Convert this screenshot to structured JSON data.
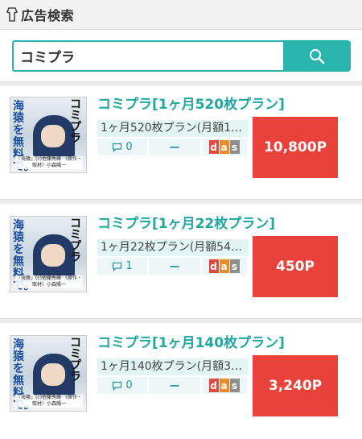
{
  "header": {
    "title": "広告検索",
    "logo_icon": "shirt-tag-icon"
  },
  "search": {
    "value": "コミプラ",
    "button_icon": "search-icon"
  },
  "items": [
    {
      "title": "コミプラ[1ヶ月520枚プラン]",
      "description": "1ヶ月520枚プラン(月額1…",
      "comments": "0",
      "dash": "ー",
      "badges": [
        "d",
        "a",
        "s"
      ],
      "price": "10,800P",
      "thumb": {
        "left_text": "海猿を無料で。",
        "right_text": "コミプラ",
        "caption": "『海猿』(c)佐藤秀峰 〈原作・取材〉小森陽一"
      }
    },
    {
      "title": "コミプラ[1ヶ月22枚プラン]",
      "description": "1ヶ月22枚プラン(月額54…",
      "comments": "1",
      "dash": "ー",
      "badges": [
        "d",
        "a",
        "s"
      ],
      "price": "450P",
      "thumb": {
        "left_text": "海猿を無料で。",
        "right_text": "コミプラ",
        "caption": "『海猿』(c)佐藤秀峰 〈原作・取材〉小森陽一"
      }
    },
    {
      "title": "コミプラ[1ヶ月140枚プラン]",
      "description": "1ヶ月140枚プラン(月額3…",
      "comments": "0",
      "dash": "ー",
      "badges": [
        "d",
        "a",
        "s"
      ],
      "price": "3,240P",
      "thumb": {
        "left_text": "海猿を無料で。",
        "right_text": "コミプラ",
        "caption": "『海猿』(c)佐藤秀峰 〈原作・取材〉小森陽一"
      }
    }
  ],
  "colors": {
    "accent": "#2ab4ae",
    "title": "#21a7a0",
    "price_bg": "#e8423a"
  }
}
